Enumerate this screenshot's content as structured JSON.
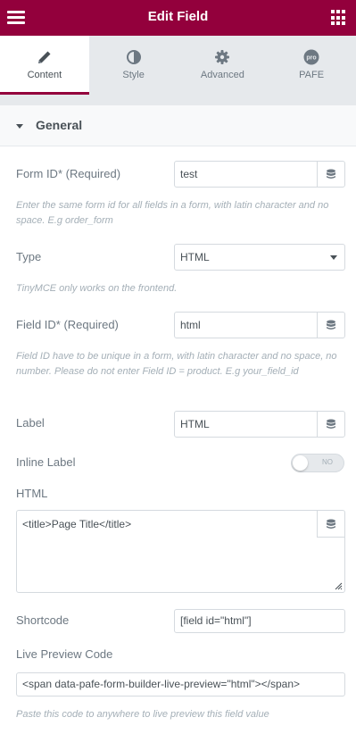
{
  "header": {
    "title": "Edit Field",
    "menu_icon": "hamburger-icon",
    "apps_icon": "grid-icon"
  },
  "tabs": [
    {
      "label": "Content",
      "icon": "pencil-icon",
      "active": true
    },
    {
      "label": "Style",
      "icon": "half-circle-icon",
      "active": false
    },
    {
      "label": "Advanced",
      "icon": "gear-icon",
      "active": false
    },
    {
      "label": "PAFE",
      "icon": "pafe-logo-icon",
      "active": false
    }
  ],
  "section": {
    "title": "General"
  },
  "fields": {
    "form_id": {
      "label": "Form ID* (Required)",
      "value": "test",
      "description": "Enter the same form id for all fields in a form, with latin character and no space. E.g order_form"
    },
    "type": {
      "label": "Type",
      "value": "HTML",
      "description": "TinyMCE only works on the frontend."
    },
    "field_id": {
      "label": "Field ID* (Required)",
      "value": "html",
      "description": "Field ID have to be unique in a form, with latin character and no space, no number. Please do not enter Field ID = product. E.g your_field_id"
    },
    "label": {
      "label": "Label",
      "value": "HTML"
    },
    "inline_label": {
      "label": "Inline Label",
      "toggle_text": "NO",
      "enabled": false
    },
    "html": {
      "label": "HTML",
      "value": "<title>Page Title</title>"
    },
    "shortcode": {
      "label": "Shortcode",
      "value": "[field id=\"html\"]"
    },
    "live_preview": {
      "label": "Live Preview Code",
      "value": "<span data-pafe-form-builder-live-preview=\"html\"></span>",
      "description": "Paste this code to anywhere to live preview this field value"
    }
  },
  "colors": {
    "brand": "#93003c",
    "panel_bg": "#e6e9ec",
    "text": "#6d7882",
    "muted": "#a4afb7"
  }
}
